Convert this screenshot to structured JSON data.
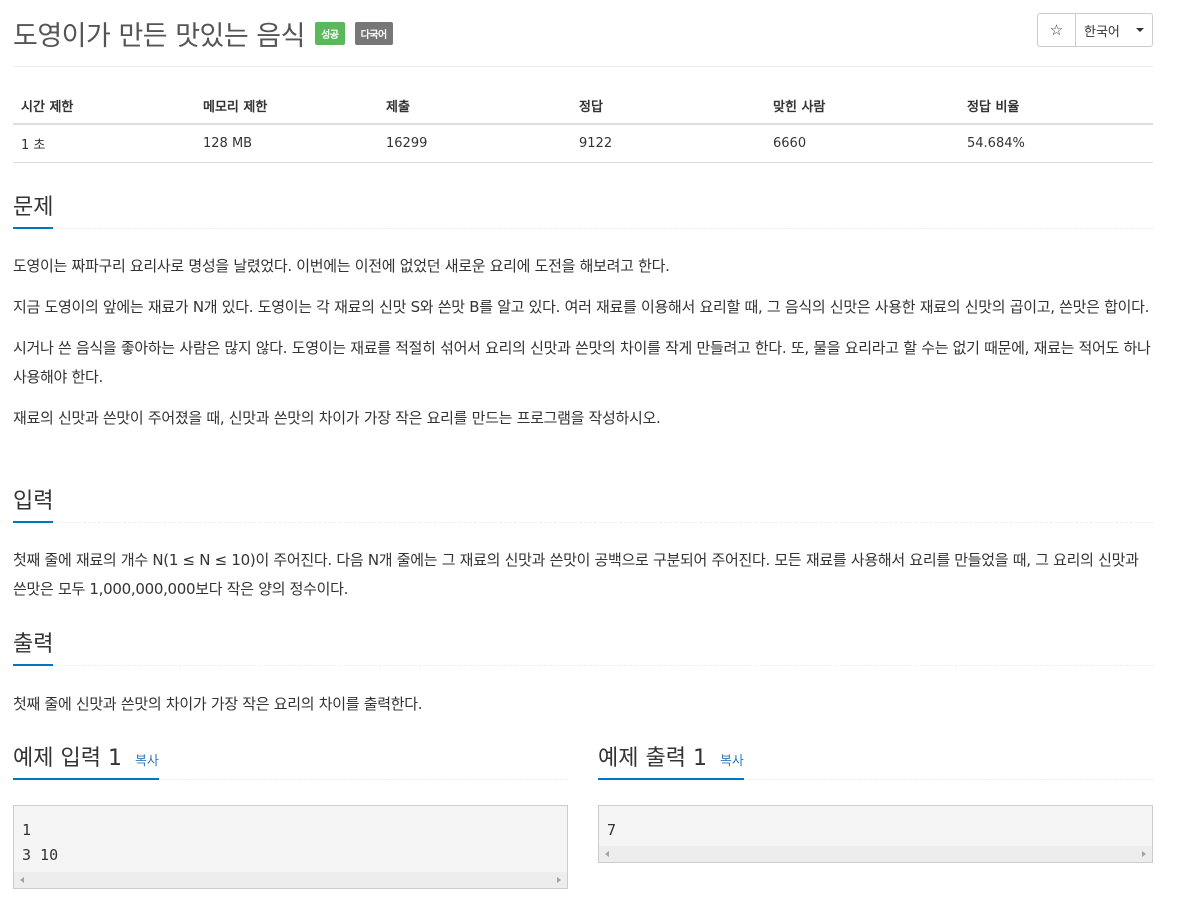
{
  "problem": {
    "title": "도영이가 만든 맛있는 음식",
    "badges": {
      "success": "성공",
      "multilang": "다국어"
    }
  },
  "toolbar": {
    "star_icon": "☆",
    "language": "한국어"
  },
  "info_table": {
    "headers": [
      "시간 제한",
      "메모리 제한",
      "제출",
      "정답",
      "맞힌 사람",
      "정답 비율"
    ],
    "values": [
      "1 초",
      "128 MB",
      "16299",
      "9122",
      "6660",
      "54.684%"
    ]
  },
  "sections": {
    "problem": {
      "title": "문제",
      "paragraphs": [
        "도영이는 짜파구리 요리사로 명성을 날렸었다. 이번에는 이전에 없었던 새로운 요리에 도전을 해보려고 한다.",
        "지금 도영이의 앞에는 재료가 N개 있다. 도영이는 각 재료의 신맛 S와 쓴맛 B를 알고 있다. 여러 재료를 이용해서 요리할 때, 그 음식의 신맛은 사용한 재료의 신맛의 곱이고, 쓴맛은 합이다.",
        "시거나 쓴 음식을 좋아하는 사람은 많지 않다. 도영이는 재료를 적절히 섞어서 요리의 신맛과 쓴맛의 차이를 작게 만들려고 한다. 또, 물을 요리라고 할 수는 없기 때문에, 재료는 적어도 하나 사용해야 한다.",
        "재료의 신맛과 쓴맛이 주어졌을 때, 신맛과 쓴맛의 차이가 가장 작은 요리를 만드는 프로그램을 작성하시오."
      ]
    },
    "input": {
      "title": "입력",
      "text": "첫째 줄에 재료의 개수 N(1 ≤ N ≤ 10)이 주어진다. 다음 N개 줄에는 그 재료의 신맛과 쓴맛이 공백으로 구분되어 주어진다. 모든 재료를 사용해서 요리를 만들었을 때, 그 요리의 신맛과 쓴맛은 모두 1,000,000,000보다 작은 양의 정수이다."
    },
    "output": {
      "title": "출력",
      "text": "첫째 줄에 신맛과 쓴맛의 차이가 가장 작은 요리의 차이를 출력한다."
    }
  },
  "samples": {
    "input": {
      "title": "예제 입력 1",
      "copy_label": "복사",
      "content": "1\n3 10"
    },
    "output": {
      "title": "예제 출력 1",
      "copy_label": "복사",
      "content": "7"
    }
  }
}
